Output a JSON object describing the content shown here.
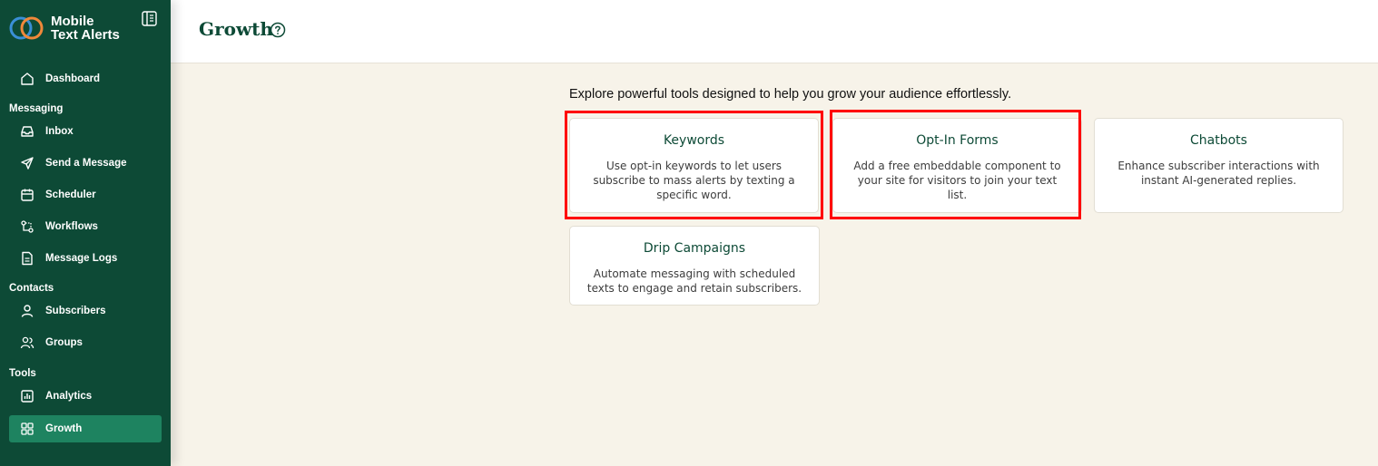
{
  "brand": {
    "line1": "Mobile",
    "line2": "Text Alerts"
  },
  "sidebar": {
    "top_items": [
      {
        "label": "Dashboard",
        "icon": "home-icon"
      }
    ],
    "sections": [
      {
        "label": "Messaging",
        "items": [
          {
            "label": "Inbox",
            "icon": "inbox-icon"
          },
          {
            "label": "Send a Message",
            "icon": "send-icon"
          },
          {
            "label": "Scheduler",
            "icon": "calendar-icon"
          },
          {
            "label": "Workflows",
            "icon": "workflow-icon"
          },
          {
            "label": "Message Logs",
            "icon": "document-icon"
          }
        ]
      },
      {
        "label": "Contacts",
        "items": [
          {
            "label": "Subscribers",
            "icon": "user-icon"
          },
          {
            "label": "Groups",
            "icon": "users-icon"
          }
        ]
      },
      {
        "label": "Tools",
        "items": [
          {
            "label": "Analytics",
            "icon": "bar-chart-icon"
          },
          {
            "label": "Growth",
            "icon": "grid-icon",
            "active": true
          }
        ]
      }
    ]
  },
  "header": {
    "title": "Growth"
  },
  "main": {
    "intro": "Explore powerful tools designed to help you grow your audience effortlessly.",
    "cards": [
      {
        "title": "Keywords",
        "description": "Use opt-in keywords to let users subscribe to mass alerts by texting a specific word.",
        "highlighted": true
      },
      {
        "title": "Opt-In Forms",
        "description": "Add a free embeddable component to your site for visitors to join your text list.",
        "highlighted": true
      },
      {
        "title": "Chatbots",
        "description": "Enhance subscriber interactions with instant AI-generated replies.",
        "highlighted": false
      },
      {
        "title": "Drip Campaigns",
        "description": "Automate messaging with scheduled texts to engage and retain subscribers.",
        "highlighted": false
      }
    ]
  },
  "colors": {
    "sidebar_bg": "#0d4a36",
    "active_item_bg": "#1e8360",
    "page_bg": "#f7f3e9",
    "accent_text": "#0d4a36",
    "highlight": "#ff0000",
    "logo_blue": "#3a8fd6",
    "logo_orange": "#f0883a"
  }
}
